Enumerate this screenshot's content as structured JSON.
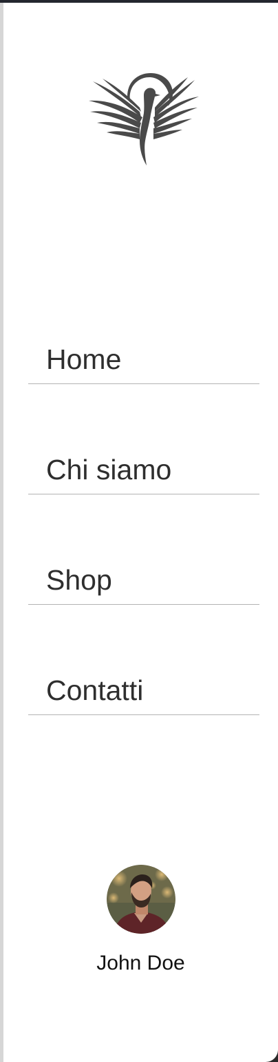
{
  "nav": {
    "items": [
      {
        "label": "Home"
      },
      {
        "label": "Chi siamo"
      },
      {
        "label": "Shop"
      },
      {
        "label": "Contatti"
      }
    ]
  },
  "profile": {
    "name": "John Doe"
  },
  "logo": {
    "icon": "phoenix-logo-icon",
    "color": "#4a4a4a"
  },
  "colors": {
    "panel_background": "#ffffff",
    "text": "#2e2e2e",
    "divider": "#b3b3b3",
    "top_bar": "#23262e"
  }
}
